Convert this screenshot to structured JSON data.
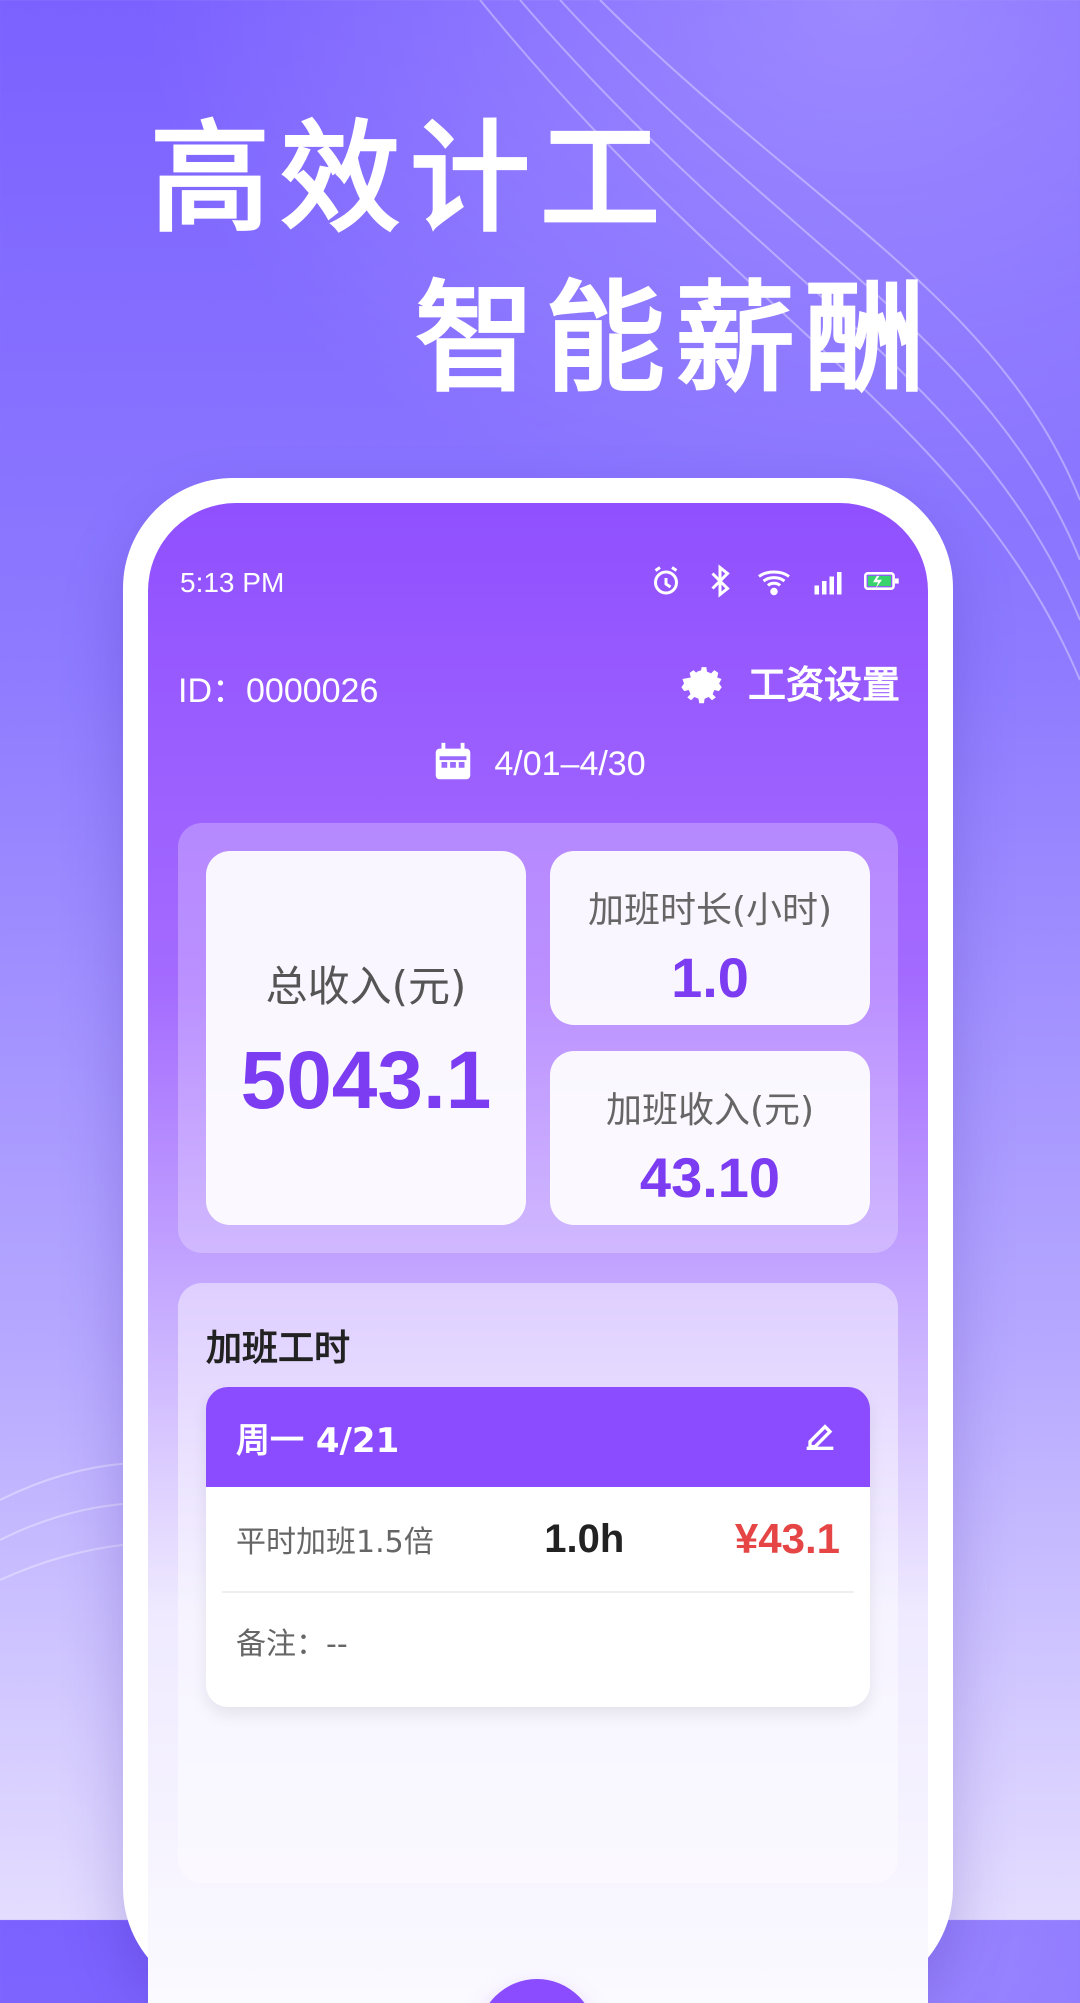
{
  "headline": {
    "line1": "高效计工",
    "line2": "智能薪酬"
  },
  "status_bar": {
    "time": "5:13 PM",
    "icons": [
      "alarm-icon",
      "bluetooth-icon",
      "wifi-icon",
      "signal-icon",
      "battery-icon"
    ]
  },
  "header": {
    "id_text": "ID：0000026",
    "settings_label": "工资设置",
    "date_range": "4/01–4/30"
  },
  "stats": {
    "total_income_label": "总收入(元)",
    "total_income_value": "5043.1",
    "overtime_hours_label": "加班时长(小时)",
    "overtime_hours_value": "1.0",
    "overtime_income_label": "加班收入(元)",
    "overtime_income_value": "43.10"
  },
  "overtime": {
    "section_title": "加班工时",
    "entries": [
      {
        "date_label": "周一  4/21",
        "type": "平时加班1.5倍",
        "hours": "1.0h",
        "amount": "¥43.1",
        "note": "备注：--"
      }
    ]
  },
  "colors": {
    "primary": "#8b4cff",
    "accent_red": "#e54545",
    "white": "#ffffff"
  }
}
